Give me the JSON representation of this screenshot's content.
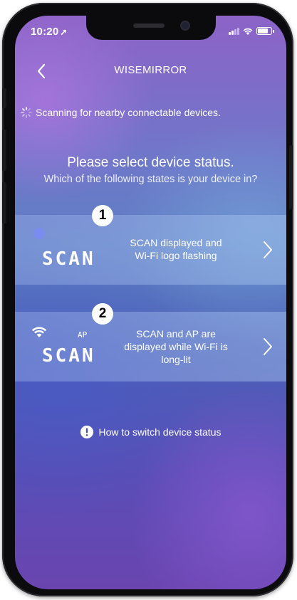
{
  "status_bar": {
    "time": "10:20"
  },
  "nav": {
    "title": "WISEMIRROR"
  },
  "scanning": {
    "text": "Scanning for nearby connectable devices."
  },
  "prompt": {
    "heading": "Please select device status.",
    "subheading": "Which of the following states is your device in?"
  },
  "options": [
    {
      "number": "1",
      "display_text": "SCAN",
      "line1": "SCAN displayed and",
      "line2": "Wi-Fi logo flashing",
      "line3": ""
    },
    {
      "number": "2",
      "display_text": "SCAN",
      "display_sub": "AP",
      "line1": "SCAN and AP are",
      "line2": "displayed while Wi-Fi is",
      "line3": "long-lit"
    }
  ],
  "help": {
    "label": "How to switch device status"
  },
  "colors": {
    "badge": "#ffffff",
    "text": "#ffffff",
    "indicator_dot": "#7b8cf0"
  },
  "icons": [
    "back-chevron-icon",
    "spinner-icon",
    "chevron-right-icon",
    "wifi-icon",
    "info-icon"
  ]
}
